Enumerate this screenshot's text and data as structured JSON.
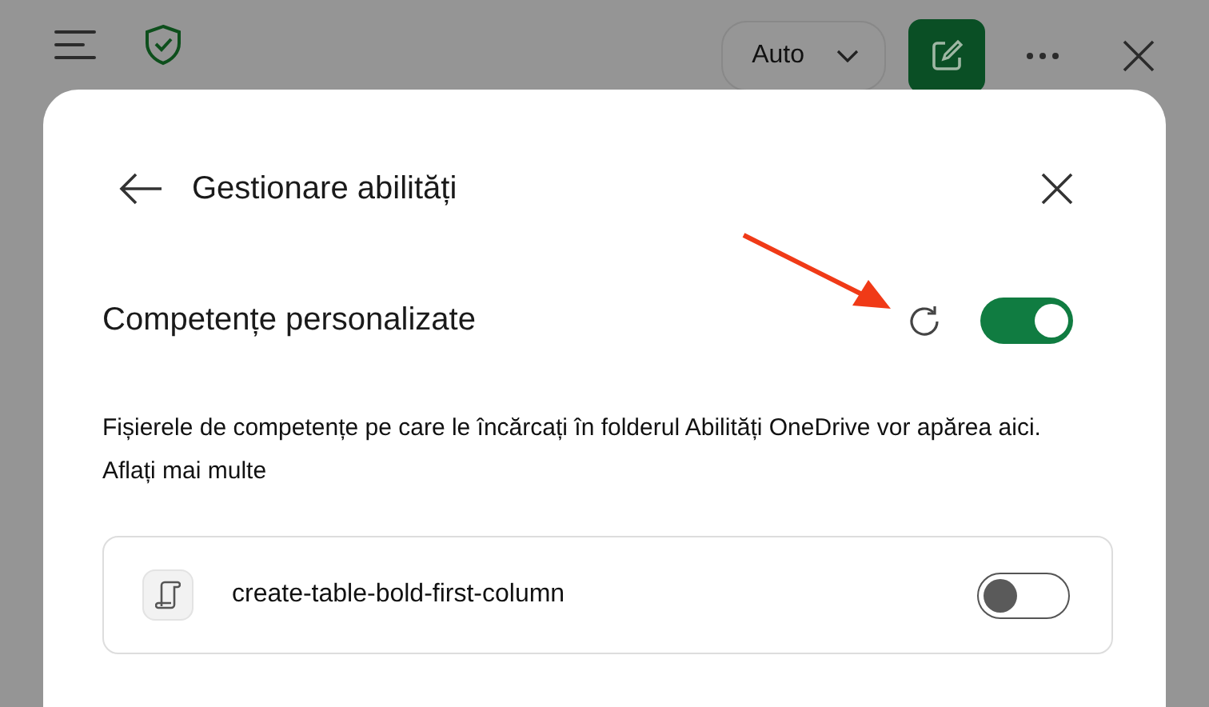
{
  "toolbar": {
    "mode_dropdown": {
      "value": "Auto"
    }
  },
  "panel": {
    "title": "Gestionare abilități",
    "section": {
      "heading": "Competențe personalizate",
      "on": true,
      "description": "Fișierele de competențe pe care le încărcați în folderul Abilități OneDrive vor apărea aici.",
      "link": "Aflați mai multe"
    },
    "skills": [
      {
        "name": "create-table-bold-first-column",
        "on": false
      }
    ]
  }
}
